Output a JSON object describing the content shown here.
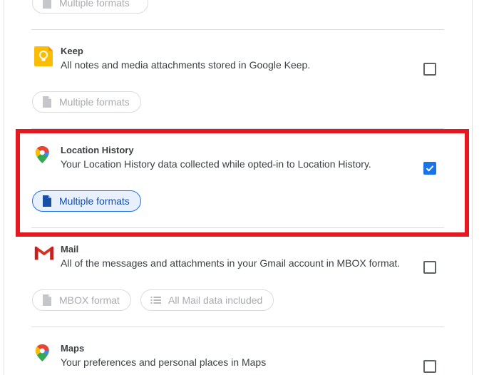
{
  "top_partial": {
    "chip_label": "Multiple formats"
  },
  "products": [
    {
      "id": "keep",
      "title": "Keep",
      "description": "All notes and media attachments stored in Google Keep.",
      "checked": false,
      "chips": [
        {
          "label": "Multiple formats",
          "icon": "file-icon",
          "active": false
        }
      ]
    },
    {
      "id": "location-history",
      "title": "Location History",
      "description": "Your Location History data collected while opted-in to Location History.",
      "checked": true,
      "chips": [
        {
          "label": "Multiple formats",
          "icon": "file-icon",
          "active": true
        }
      ]
    },
    {
      "id": "mail",
      "title": "Mail",
      "description": "All of the messages and attachments in your Gmail account in MBOX format.",
      "checked": false,
      "chips": [
        {
          "label": "MBOX format",
          "icon": "file-icon",
          "active": false
        },
        {
          "label": "All Mail data included",
          "icon": "list-icon",
          "active": false
        }
      ]
    },
    {
      "id": "maps",
      "title": "Maps",
      "description": "Your preferences and personal places in Maps",
      "checked": false,
      "chips": []
    }
  ],
  "colors": {
    "accent": "#1a73e8",
    "highlight": "#e5171f",
    "chip_active_bg": "#e8f0fe",
    "chip_active_text": "#174ea6",
    "disabled_text": "#a8abaf"
  }
}
